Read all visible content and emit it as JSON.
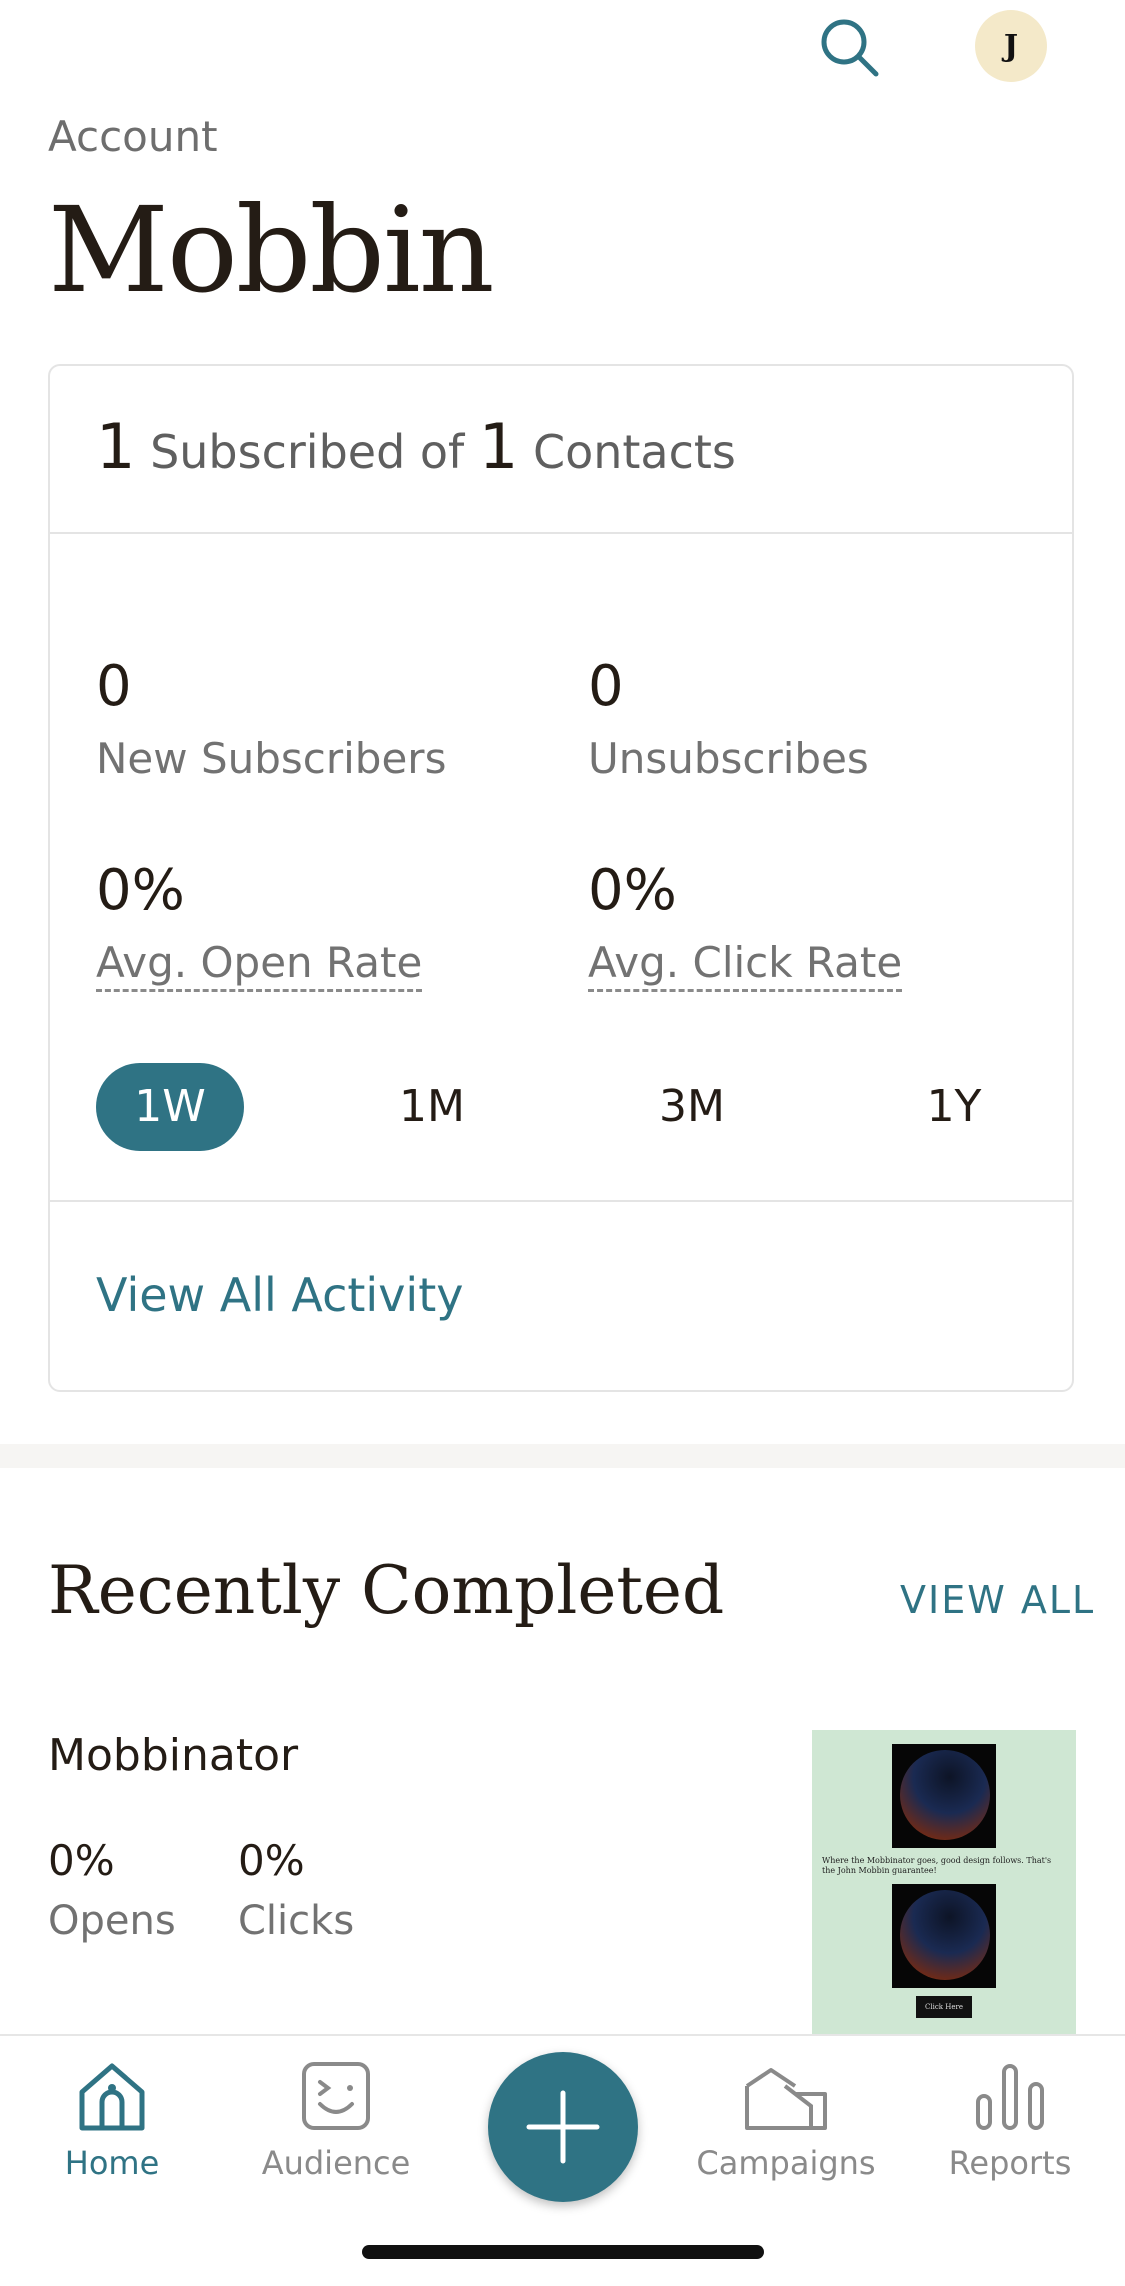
{
  "header": {
    "search_icon": "search-icon",
    "avatar_initial": "J",
    "account_label": "Account",
    "title": "Mobbin"
  },
  "stats": {
    "subscribed_count": "1",
    "subscribed_text": "Subscribed of",
    "contacts_count": "1",
    "contacts_text": "Contacts",
    "new_subscribers_value": "0",
    "new_subscribers_label": "New Subscribers",
    "unsubscribes_value": "0",
    "unsubscribes_label": "Unsubscribes",
    "open_rate_value": "0%",
    "open_rate_label": "Avg. Open Rate",
    "click_rate_value": "0%",
    "click_rate_label": "Avg. Click Rate",
    "periods": [
      "1W",
      "1M",
      "3M",
      "1Y"
    ],
    "active_period": "1W",
    "view_activity_label": "View All Activity"
  },
  "recent": {
    "title": "Recently Completed",
    "view_all_label": "VIEW ALL",
    "campaign": {
      "name": "Mobbinator",
      "opens_value": "0%",
      "opens_label": "Opens",
      "clicks_value": "0%",
      "clicks_label": "Clicks",
      "thumbnail_text": "Where the Mobbinator goes, good design follows. That's the John Mobbin guarantee!",
      "thumbnail_button": "Click Here"
    }
  },
  "nav": {
    "items": [
      {
        "label": "Home",
        "icon": "home-icon"
      },
      {
        "label": "Audience",
        "icon": "audience-icon"
      },
      {
        "label": "Campaigns",
        "icon": "campaigns-icon"
      },
      {
        "label": "Reports",
        "icon": "reports-icon"
      }
    ],
    "fab_icon": "plus-icon"
  },
  "colors": {
    "accent": "#2f7384",
    "text": "#241c15",
    "muted": "#727272",
    "thumbnail_bg": "#cfe7d3"
  }
}
